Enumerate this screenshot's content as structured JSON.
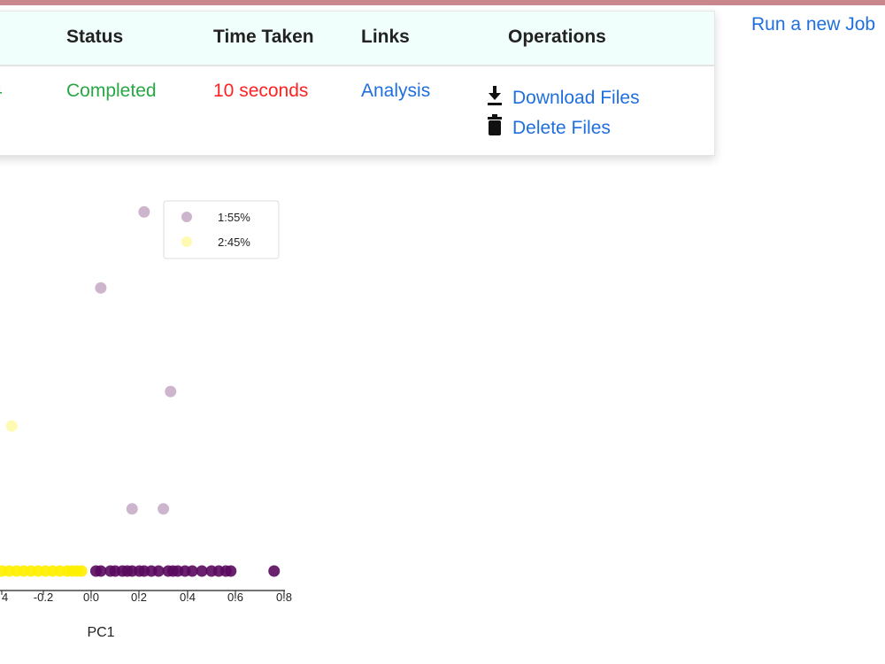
{
  "table": {
    "headers": [
      "Status",
      "Time Taken",
      "Links",
      "Operations"
    ],
    "row": {
      "id_partial": "4",
      "status": "Completed",
      "time_taken": "10 seconds",
      "link": "Analysis",
      "operations": [
        "Download Files",
        "Delete Files"
      ]
    }
  },
  "run_new_job": "Run a new Job",
  "colors": {
    "green": "#28a745",
    "red": "#ff2222",
    "link_blue": "#1f6fde",
    "cluster1": "#5a0a5e",
    "cluster2": "#ffee00"
  },
  "icons": [
    "download-icon",
    "trash-icon"
  ],
  "chart_data": {
    "type": "scatter",
    "xlabel": "PC1",
    "x_ticks": [
      "4",
      "-0.2",
      "0!0",
      "0!2",
      "0!4",
      "0!6",
      "0!8"
    ],
    "legend": [
      "1:55%",
      "2:45%"
    ],
    "series": [
      {
        "name": "1:55%",
        "points": [
          {
            "x": 0.22,
            "y": 5.2
          },
          {
            "x": 0.04,
            "y": 4.1
          },
          {
            "x": 0.33,
            "y": 2.6
          },
          {
            "x": 0.17,
            "y": 0.9
          },
          {
            "x": 0.3,
            "y": 0.9
          },
          {
            "x": 0.02,
            "y": 0
          },
          {
            "x": 0.04,
            "y": 0
          },
          {
            "x": 0.08,
            "y": 0
          },
          {
            "x": 0.1,
            "y": 0
          },
          {
            "x": 0.13,
            "y": 0
          },
          {
            "x": 0.15,
            "y": 0
          },
          {
            "x": 0.17,
            "y": 0
          },
          {
            "x": 0.2,
            "y": 0
          },
          {
            "x": 0.22,
            "y": 0
          },
          {
            "x": 0.25,
            "y": 0
          },
          {
            "x": 0.28,
            "y": 0
          },
          {
            "x": 0.32,
            "y": 0
          },
          {
            "x": 0.34,
            "y": 0
          },
          {
            "x": 0.36,
            "y": 0
          },
          {
            "x": 0.39,
            "y": 0
          },
          {
            "x": 0.42,
            "y": 0
          },
          {
            "x": 0.46,
            "y": 0
          },
          {
            "x": 0.5,
            "y": 0
          },
          {
            "x": 0.53,
            "y": 0
          },
          {
            "x": 0.56,
            "y": 0
          },
          {
            "x": 0.58,
            "y": 0
          },
          {
            "x": 0.76,
            "y": 0
          }
        ]
      },
      {
        "name": "2:45%",
        "points": [
          {
            "x": -0.33,
            "y": 2.1
          },
          {
            "x": -0.4,
            "y": 0
          },
          {
            "x": -0.37,
            "y": 0
          },
          {
            "x": -0.34,
            "y": 0
          },
          {
            "x": -0.31,
            "y": 0
          },
          {
            "x": -0.28,
            "y": 0
          },
          {
            "x": -0.25,
            "y": 0
          },
          {
            "x": -0.22,
            "y": 0
          },
          {
            "x": -0.19,
            "y": 0
          },
          {
            "x": -0.16,
            "y": 0
          },
          {
            "x": -0.13,
            "y": 0
          },
          {
            "x": -0.1,
            "y": 0
          },
          {
            "x": -0.08,
            "y": 0
          },
          {
            "x": -0.06,
            "y": 0
          },
          {
            "x": -0.04,
            "y": 0
          }
        ]
      }
    ]
  }
}
